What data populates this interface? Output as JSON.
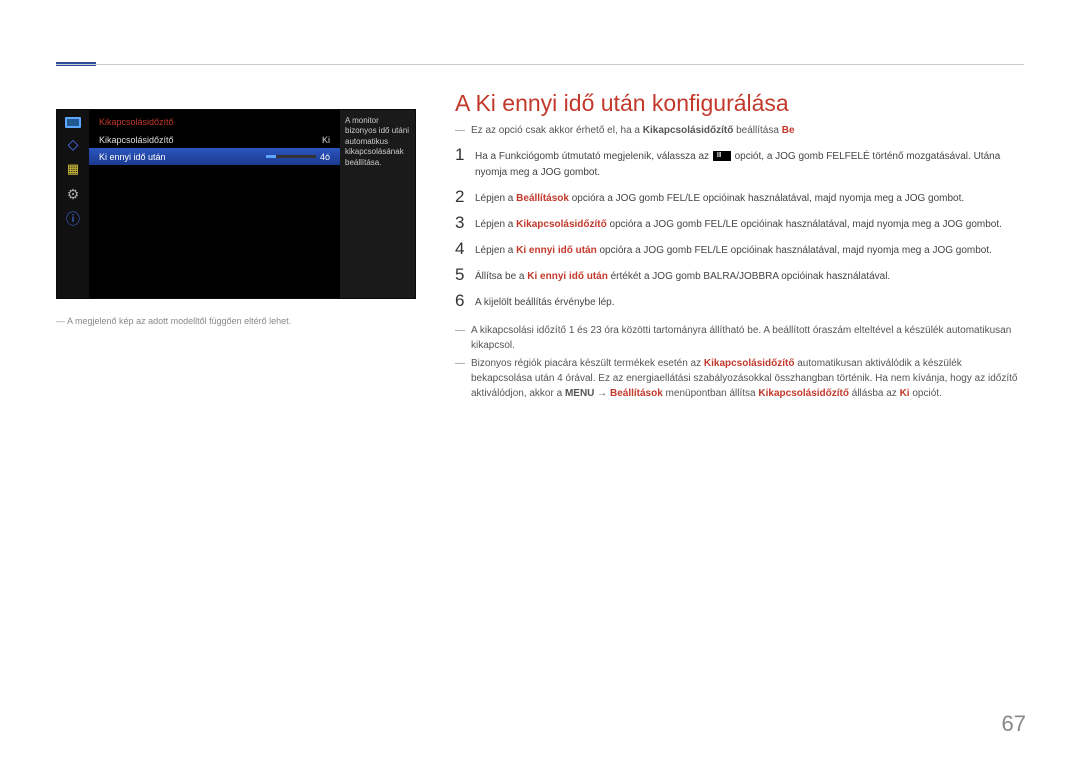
{
  "page": {
    "number": "67"
  },
  "osd": {
    "panelTitle": "Kikapcsolásidőzítő",
    "row1": {
      "label": "Kikapcsolásidőzítő",
      "value": "Ki"
    },
    "row2": {
      "label": "Ki ennyi idő után",
      "value": "4ó"
    },
    "tip": "A monitor bizonyos idő utáni automatikus kikapcsolásának beállítása.",
    "caption": "A megjelenő kép az adott modelltől függően eltérő lehet."
  },
  "title": "A Ki ennyi idő után konfigurálása",
  "intro": {
    "pre": "Ez az opció csak akkor érhető el, ha a ",
    "bold1": "Kikapcsolásidőzítő",
    "mid": " beállítása ",
    "bold2": "Be"
  },
  "steps": {
    "s1a": "Ha a Funkciógomb útmutató megjelenik, válassza az ",
    "s1b": " opciót, a JOG gomb FELFELÉ történő mozgatásával. Utána nyomja meg a JOG gombot.",
    "s2a": "Lépjen a ",
    "s2r": "Beállítások",
    "s2b": " opcióra a JOG gomb FEL/LE opcióinak használatával, majd nyomja meg a JOG gombot.",
    "s3a": "Lépjen a ",
    "s3r": "Kikapcsolásidőzítő",
    "s3b": " opcióra a JOG gomb FEL/LE opcióinak használatával, majd nyomja meg a JOG gombot.",
    "s4a": "Lépjen a ",
    "s4r": "Ki ennyi idő után",
    "s4b": " opcióra a JOG gomb FEL/LE opcióinak használatával, majd nyomja meg a JOG gombot.",
    "s5a": "Állítsa be a ",
    "s5r": "Ki ennyi idő után",
    "s5b": " értékét a JOG gomb BALRA/JOBBRA opcióinak használatával.",
    "s6": "A kijelölt beállítás érvénybe lép."
  },
  "footnotes": {
    "f1": "A kikapcsolási időzítő 1 és 23 óra közötti tartományra állítható be. A beállított óraszám elteltével a készülék automatikusan kikapcsol.",
    "f2a": "Bizonyos régiók piacára készült termékek esetén az ",
    "f2r1": "Kikapcsolásidőzítő",
    "f2b": " automatikusan aktiválódik a készülék bekapcsolása után 4 órával. Ez az energiaellátási szabályozásokkal összhangban történik. Ha nem kívánja, hogy az időzítő aktiválódjon, akkor a ",
    "f2bold1": "MENU",
    "f2arrow": " → ",
    "f2r2": "Beállítások",
    "f2c": " menüpontban állítsa ",
    "f2r3": "Kikapcsolásidőzítő",
    "f2d": " állásba az ",
    "f2r4": "Ki",
    "f2e": " opciót."
  }
}
